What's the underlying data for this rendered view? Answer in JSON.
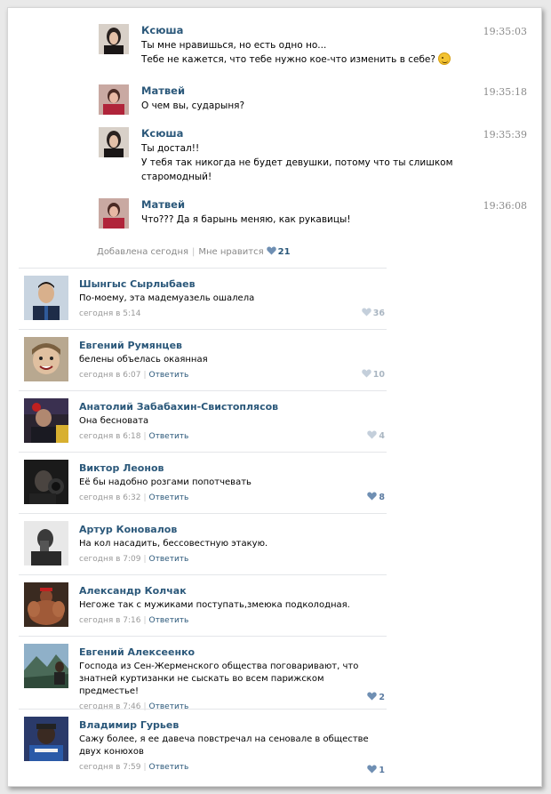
{
  "post": {
    "messages": [
      {
        "author": "Ксюша",
        "time": "19:35:03",
        "lines": [
          "Ты мне нравишься, но есть одно но...",
          "Тебе не кажется, что тебе нужно кое-что изменить в себе?"
        ],
        "emoji": "wink-emoji"
      },
      {
        "author": "Матвей",
        "time": "19:35:18",
        "lines": [
          "О чем вы, сударыня?"
        ]
      },
      {
        "author": "Ксюша",
        "time": "19:35:39",
        "lines": [
          "Ты достал!!",
          "У тебя так никогда не будет девушки, потому что ты слишком",
          "старомодный!"
        ]
      },
      {
        "author": "Матвей",
        "time": "19:36:08",
        "lines": [
          "Что??? Да я барынь меняю, как рукавицы!"
        ]
      }
    ],
    "added": "Добавлена сегодня",
    "like_label": "Мне нравится",
    "likes": "21"
  },
  "reply_label": "Ответить",
  "comments": [
    {
      "author": "Шынгыс Сырлыбаев",
      "lines": [
        "По-моему, эта мадемуазель ошалела"
      ],
      "date": "сегодня в 5:14",
      "likes": "36",
      "has_reply": false
    },
    {
      "author": "Евгений Румянцев",
      "lines": [
        "белены объелась окаянная"
      ],
      "date": "сегодня в 6:07",
      "likes": "10",
      "has_reply": true
    },
    {
      "author": "Анатолий Забабахин-Свистоплясов",
      "lines": [
        "Она бесновата"
      ],
      "date": "сегодня в 6:18",
      "likes": "4",
      "has_reply": true
    },
    {
      "author": "Виктор Леонов",
      "lines": [
        "Её бы надобно розгами попотчевать"
      ],
      "date": "сегодня в 6:32",
      "likes": "8",
      "has_reply": true
    },
    {
      "author": "Артур Коновалов",
      "lines": [
        "На кол насадить, бессовестную этакую."
      ],
      "date": "сегодня в 7:09",
      "likes": "",
      "has_reply": true
    },
    {
      "author": "Александр Колчак",
      "lines": [
        "Негоже так с мужиками поступать,змеюка подколодная."
      ],
      "date": "сегодня в 7:16",
      "likes": "",
      "has_reply": true
    },
    {
      "author": "Евгений Алексеенко",
      "lines": [
        "Господа из Сен-Жерменского общества поговаривают, что",
        "знатней куртизанки не сыскать во всем парижском предместье!"
      ],
      "date": "сегодня в 7:46",
      "likes": "2",
      "has_reply": true
    },
    {
      "author": "Владимир Гурьев",
      "lines": [
        "Сажу более, я ее давеча повстречал на сеновале в обществе",
        "двух конюхов"
      ],
      "date": "сегодня в 7:59",
      "likes": "1",
      "has_reply": true
    }
  ],
  "colors": {
    "link": "#2b587a",
    "meta": "#999999",
    "like_heart": "#6f8fb3"
  }
}
